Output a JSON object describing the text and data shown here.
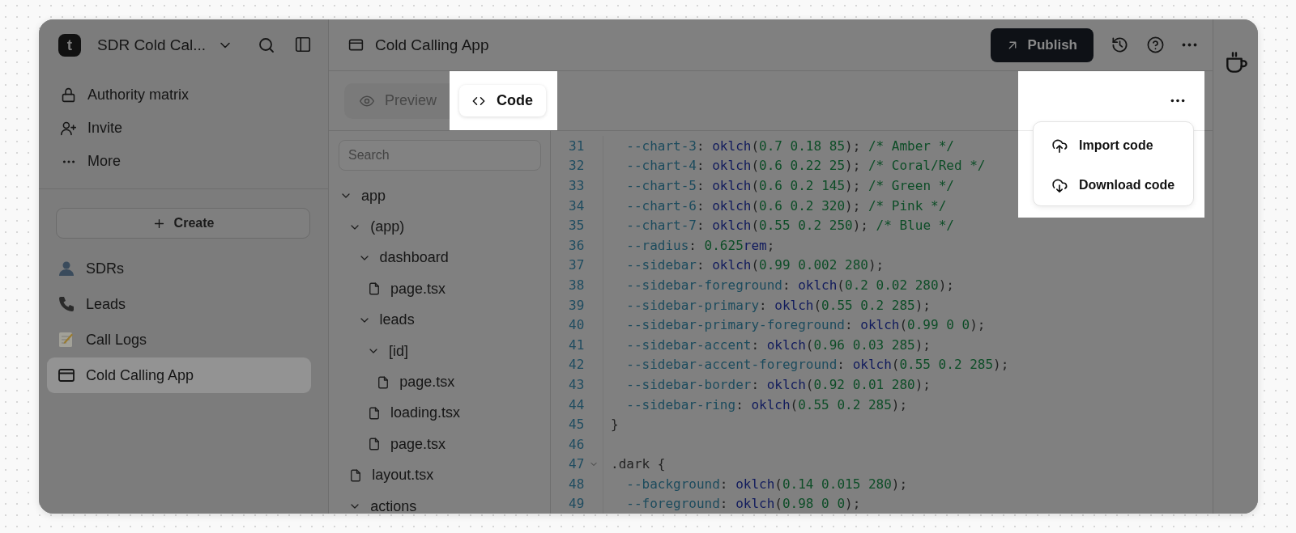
{
  "sidebar": {
    "logo": "t",
    "workspace": "SDR Cold Cal...",
    "nav": [
      {
        "label": "Authority matrix"
      },
      {
        "label": "Invite"
      },
      {
        "label": "More"
      }
    ],
    "create_button": "Create",
    "pages": [
      {
        "label": "SDRs",
        "selected": false
      },
      {
        "label": "Leads",
        "selected": false
      },
      {
        "label": "Call Logs",
        "selected": false
      },
      {
        "label": "Cold Calling App",
        "selected": true
      }
    ]
  },
  "header": {
    "title": "Cold Calling App",
    "publish": "Publish"
  },
  "tabs": [
    {
      "label": "Preview",
      "selected": false,
      "highlighted": false
    },
    {
      "label": "Code",
      "selected": true,
      "highlighted": true
    }
  ],
  "file_tree": {
    "search": {
      "placeholder": "Search"
    },
    "items": [
      {
        "label": "app",
        "kind": "folder",
        "expanded": true,
        "children": [
          {
            "label": "(app)",
            "kind": "folder",
            "expanded": true,
            "children": [
              {
                "label": "dashboard",
                "kind": "folder",
                "expanded": true,
                "children": [
                  {
                    "label": "page.tsx",
                    "kind": "file"
                  }
                ]
              },
              {
                "label": "leads",
                "kind": "folder",
                "expanded": true,
                "children": [
                  {
                    "label": "[id]",
                    "kind": "folder",
                    "expanded": true,
                    "children": [
                      {
                        "label": "page.tsx",
                        "kind": "file"
                      }
                    ]
                  },
                  {
                    "label": "loading.tsx",
                    "kind": "file"
                  },
                  {
                    "label": "page.tsx",
                    "kind": "file"
                  }
                ]
              }
            ]
          },
          {
            "label": "layout.tsx",
            "kind": "file"
          },
          {
            "label": "actions",
            "kind": "folder",
            "expanded": true
          }
        ]
      }
    ]
  },
  "editor": {
    "lines": [
      {
        "number": "31",
        "text": "  --chart-3: oklch(0.7 0.18 85); /* Amber */",
        "foldable": false
      },
      {
        "number": "32",
        "text": "  --chart-4: oklch(0.6 0.22 25); /* Coral/Red */",
        "foldable": false
      },
      {
        "number": "33",
        "text": "  --chart-5: oklch(0.6 0.2 145); /* Green */",
        "foldable": false
      },
      {
        "number": "34",
        "text": "  --chart-6: oklch(0.6 0.2 320); /* Pink */",
        "foldable": false
      },
      {
        "number": "35",
        "text": "  --chart-7: oklch(0.55 0.2 250); /* Blue */",
        "foldable": false
      },
      {
        "number": "36",
        "text": "  --radius: 0.625rem;",
        "foldable": false
      },
      {
        "number": "37",
        "text": "  --sidebar: oklch(0.99 0.002 280);",
        "foldable": false
      },
      {
        "number": "38",
        "text": "  --sidebar-foreground: oklch(0.2 0.02 280);",
        "foldable": false
      },
      {
        "number": "39",
        "text": "  --sidebar-primary: oklch(0.55 0.2 285);",
        "foldable": false
      },
      {
        "number": "40",
        "text": "  --sidebar-primary-foreground: oklch(0.99 0 0);",
        "foldable": false
      },
      {
        "number": "41",
        "text": "  --sidebar-accent: oklch(0.96 0.03 285);",
        "foldable": false
      },
      {
        "number": "42",
        "text": "  --sidebar-accent-foreground: oklch(0.55 0.2 285);",
        "foldable": false
      },
      {
        "number": "43",
        "text": "  --sidebar-border: oklch(0.92 0.01 280);",
        "foldable": false
      },
      {
        "number": "44",
        "text": "  --sidebar-ring: oklch(0.55 0.2 285);",
        "foldable": false
      },
      {
        "number": "45",
        "text": "}",
        "foldable": false
      },
      {
        "number": "46",
        "foldable": false
      },
      {
        "number": "47",
        "text": ".dark {",
        "foldable": true
      },
      {
        "number": "48",
        "text": "  --background: oklch(0.14 0.015 280);",
        "foldable": false
      },
      {
        "number": "49",
        "text": "  --foreground: oklch(0.98 0 0);",
        "foldable": false
      }
    ]
  },
  "code_menu": {
    "highlighted": true,
    "items": [
      {
        "label": "Import code"
      },
      {
        "label": "Download code"
      }
    ]
  }
}
